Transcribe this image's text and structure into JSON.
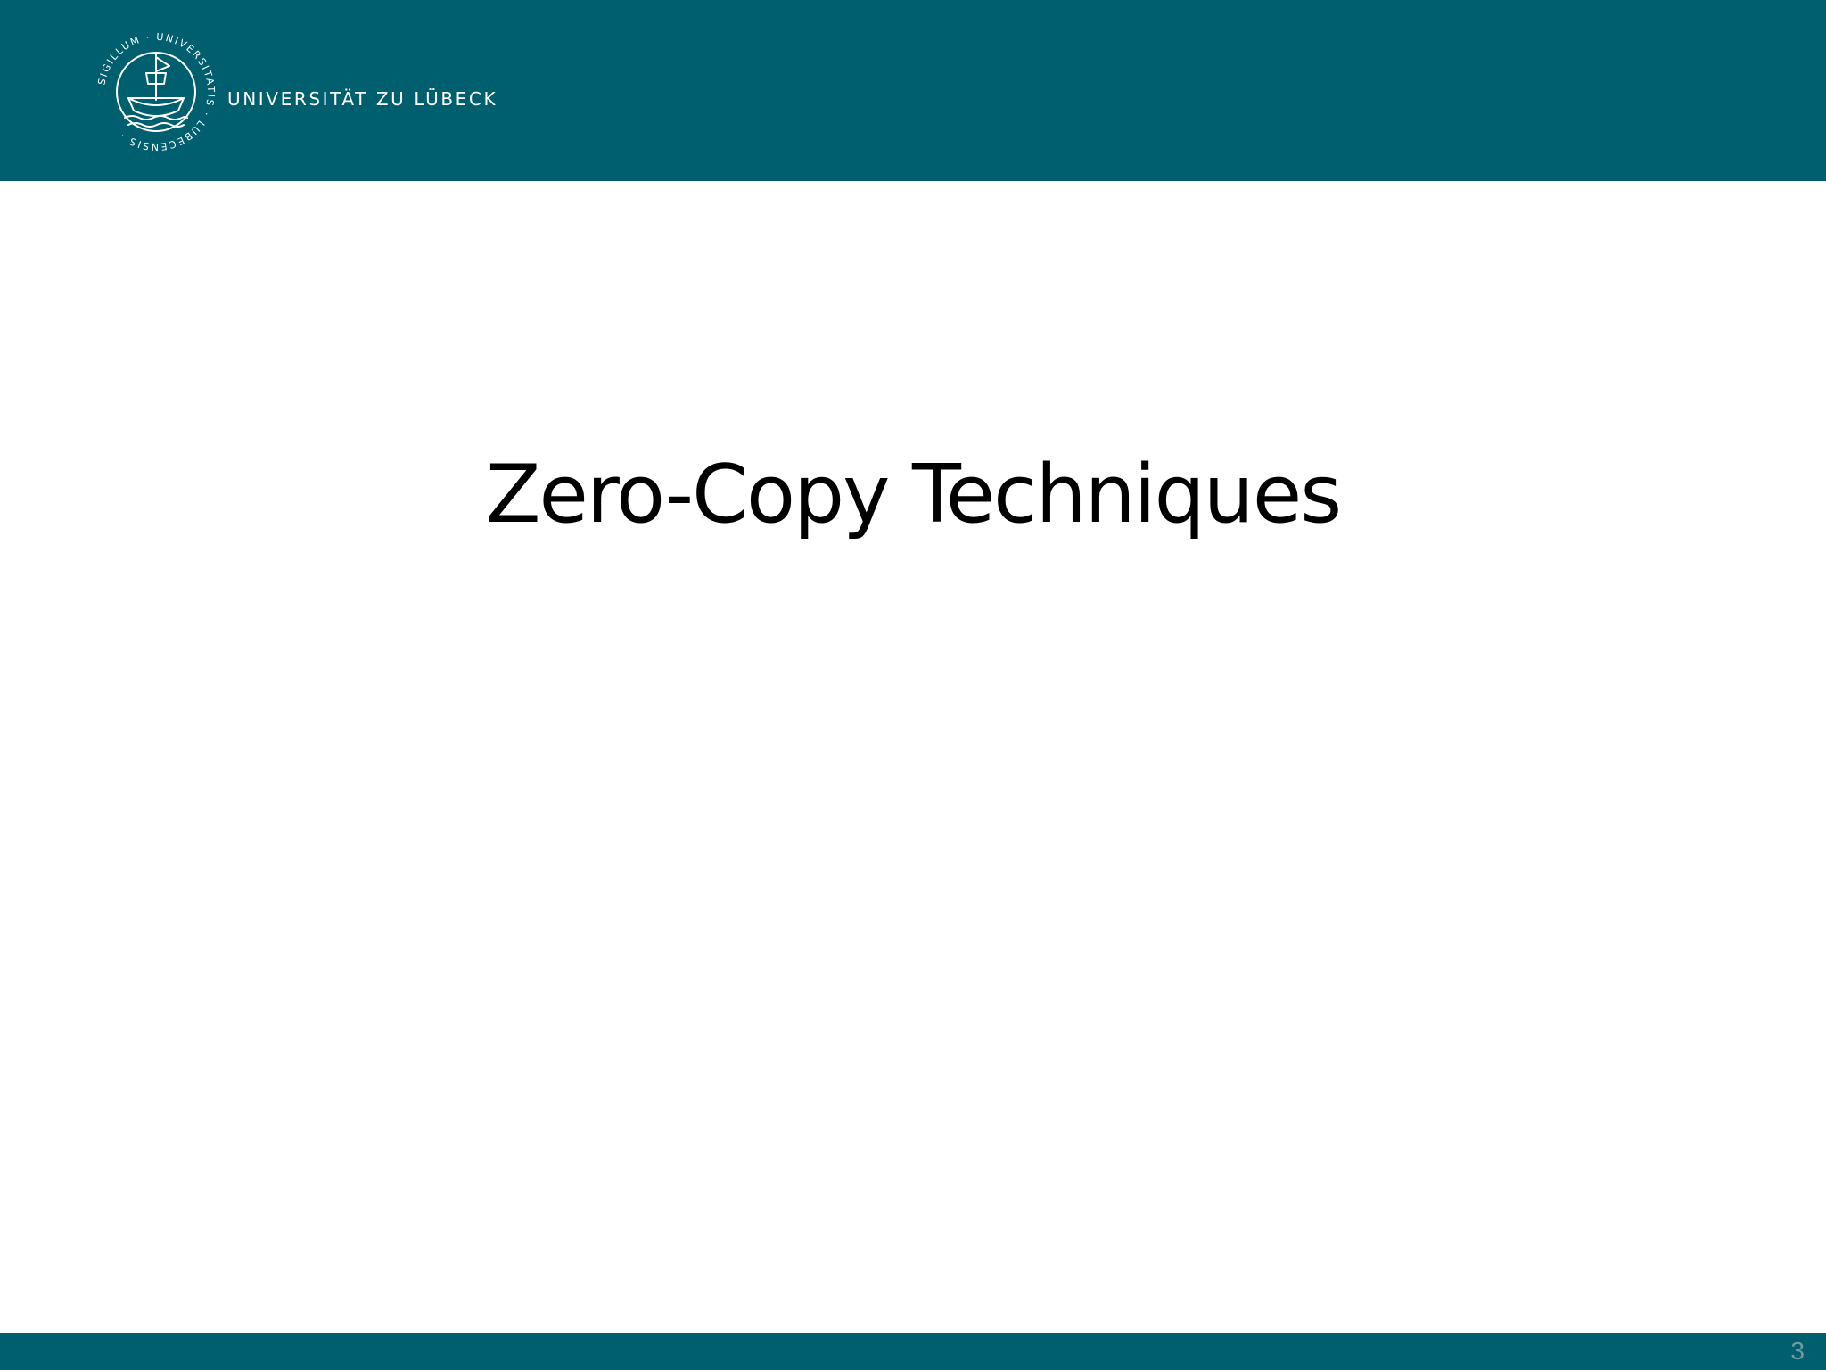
{
  "header": {
    "university_name": "UNIVERSITÄT ZU LÜBECK",
    "seal_text": "SIGILLUM · UNIVERSITATIS · LUBECENSIS",
    "bar_color": "#005f6e",
    "seal_icon": "ship-seal-icon"
  },
  "slide": {
    "title": "Zero-Copy Techniques",
    "page_number": "3"
  },
  "footer": {
    "bar_color": "#005f6e",
    "page_number_color": "#6f9aa3"
  }
}
